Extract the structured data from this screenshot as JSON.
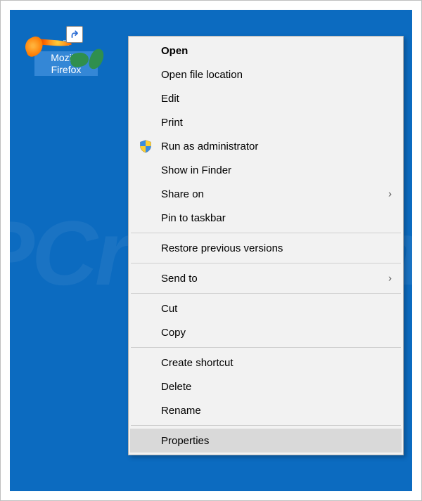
{
  "desktop": {
    "background_color": "#0c6bc0",
    "watermark_text": "PCrisk.com"
  },
  "shortcut": {
    "label_line1": "Mozilla",
    "label_line2": "Firefox",
    "icon_name": "firefox-icon",
    "has_shortcut_overlay": true
  },
  "context_menu": {
    "items": [
      {
        "label": "Open",
        "bold": true
      },
      {
        "label": "Open file location"
      },
      {
        "label": "Edit"
      },
      {
        "label": "Print"
      },
      {
        "label": "Run as administrator",
        "icon": "uac-shield"
      },
      {
        "label": "Show in Finder"
      },
      {
        "label": "Share on",
        "submenu": true
      },
      {
        "label": "Pin to taskbar"
      },
      {
        "separator": true
      },
      {
        "label": "Restore previous versions"
      },
      {
        "separator": true
      },
      {
        "label": "Send to",
        "submenu": true
      },
      {
        "separator": true
      },
      {
        "label": "Cut"
      },
      {
        "label": "Copy"
      },
      {
        "separator": true
      },
      {
        "label": "Create shortcut"
      },
      {
        "label": "Delete"
      },
      {
        "label": "Rename"
      },
      {
        "separator": true
      },
      {
        "label": "Properties",
        "highlight": true
      }
    ]
  }
}
